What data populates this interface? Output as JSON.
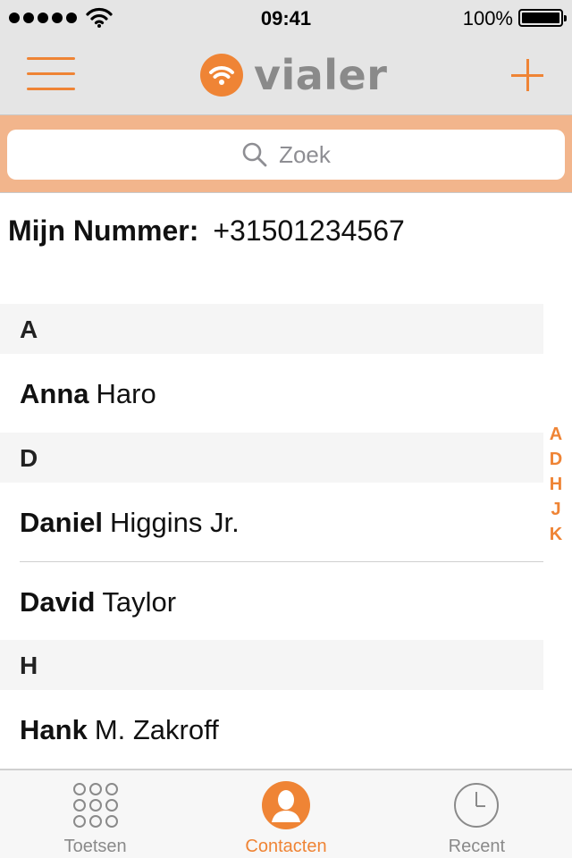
{
  "status_bar": {
    "time": "09:41",
    "battery_percent": "100%",
    "signal_bars": 5,
    "battery_level": 1.0
  },
  "nav": {
    "app_name": "vialer"
  },
  "search": {
    "placeholder": "Zoek"
  },
  "my_number": {
    "label": "Mijn Nummer:",
    "value": "+31501234567"
  },
  "sections": [
    {
      "letter": "A",
      "contacts": [
        {
          "first": "Anna",
          "last": "Haro"
        }
      ]
    },
    {
      "letter": "D",
      "contacts": [
        {
          "first": "Daniel",
          "last": "Higgins Jr."
        },
        {
          "first": "David",
          "last": "Taylor"
        }
      ]
    },
    {
      "letter": "H",
      "contacts": [
        {
          "first": "Hank",
          "last": "M. Zakroff"
        }
      ]
    }
  ],
  "section_index": [
    "A",
    "D",
    "H",
    "J",
    "K"
  ],
  "tabs": [
    {
      "label": "Toetsen",
      "icon": "keypad-icon",
      "active": false
    },
    {
      "label": "Contacten",
      "icon": "contacts-icon",
      "active": true
    },
    {
      "label": "Recent",
      "icon": "clock-icon",
      "active": false
    }
  ],
  "colors": {
    "accent": "#ef8435",
    "search_bar_bg": "#f2b58c",
    "nav_bg": "#e5e5e5",
    "section_bg": "#f5f5f5",
    "inactive": "#8a8a8a"
  }
}
